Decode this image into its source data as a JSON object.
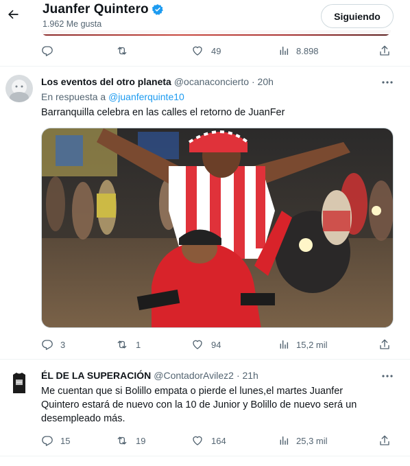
{
  "header": {
    "title": "Juanfer Quintero",
    "likes": "1.962 Me gusta",
    "follow_label": "Siguiendo"
  },
  "top_actions": {
    "replies": "",
    "retweets": "",
    "likes": "49",
    "views": "8.898"
  },
  "tweets": [
    {
      "name": "Los eventos del otro planeta",
      "handle": "@ocanaconcierto",
      "time": "· 20h",
      "reply_prefix": "En respuesta a",
      "reply_to": "@juanferquinte10",
      "text": "Barranquilla celebra en las calles el retorno de JuanFer",
      "replies": "3",
      "retweets": "1",
      "likes": "94",
      "views": "15,2 mil"
    },
    {
      "name": "ÉL DE LA SUPERACIÓN",
      "handle": "@ContadorAvilez2",
      "time": "· 21h",
      "text": "Me cuentan que si Bolillo empata o pierde el lunes,el martes Juanfer Quintero estará de nuevo con la 10 de Junior y Bolillo de nuevo será un desempleado más.",
      "replies": "15",
      "retweets": "19",
      "likes": "164",
      "views": "25,3 mil"
    }
  ],
  "icons": {
    "back": "arrow-left-icon",
    "verified": "verified-badge-icon",
    "reply": "reply-icon",
    "retweet": "retweet-icon",
    "like": "heart-icon",
    "views": "views-icon",
    "share": "share-icon",
    "more": "more-icon"
  },
  "colors": {
    "accent": "#1d9bf0",
    "muted": "#536471",
    "text": "#0f1419"
  }
}
